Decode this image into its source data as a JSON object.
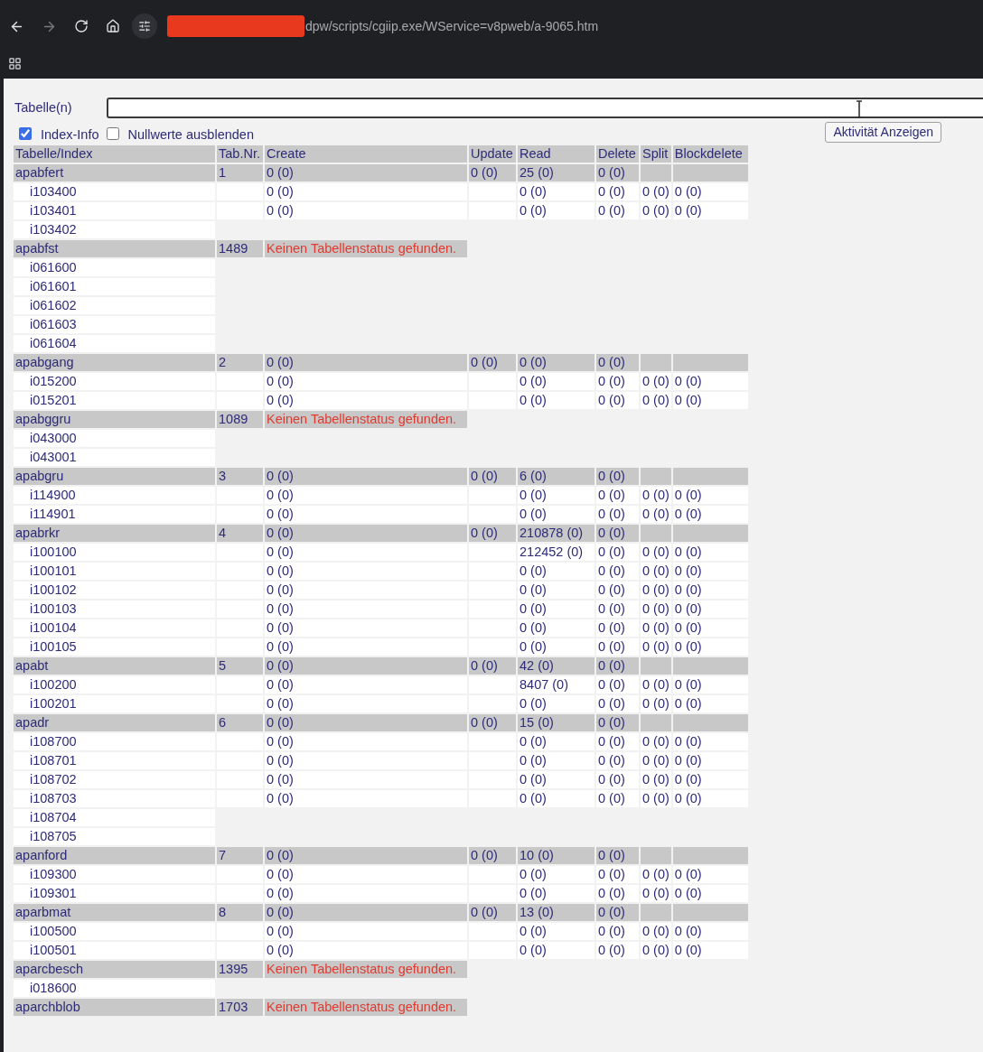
{
  "browser": {
    "url": "dpw/scripts/cgiip.exe/WService=v8pweb/a-9065.htm",
    "forward_disabled": true
  },
  "form": {
    "label": "Tabelle(n)",
    "checkboxes": [
      {
        "label": "Index-Info",
        "checked": true
      },
      {
        "label": "Nullwerte ausblenden",
        "checked": false
      }
    ],
    "button": "Aktivität Anzeigen"
  },
  "table": {
    "columns": [
      "Tabelle/Index",
      "Tab.Nr.",
      "Create",
      "Update",
      "Read",
      "Delete",
      "Split",
      "Blockdelete"
    ],
    "rows": [
      {
        "kind": "table",
        "name": "apabfert",
        "tab_nr": "1",
        "create": "0 (0)",
        "update": "0 (0)",
        "read": "25 (0)",
        "delete": "0 (0)"
      },
      {
        "kind": "index",
        "name": "i103400",
        "stats": {
          "create": "0 (0)",
          "read": "0 (0)",
          "delete": "0 (0)",
          "split": "0 (0)",
          "blockdelete": "0 (0)"
        }
      },
      {
        "kind": "index",
        "name": "i103401",
        "stats": {
          "create": "0 (0)",
          "read": "0 (0)",
          "delete": "0 (0)",
          "split": "0 (0)",
          "blockdelete": "0 (0)"
        }
      },
      {
        "kind": "index",
        "name": "i103402"
      },
      {
        "kind": "missing",
        "name": "apabfst",
        "tab_nr": "1489",
        "message": "Keinen Tabellenstatus gefunden."
      },
      {
        "kind": "index",
        "name": "i061600"
      },
      {
        "kind": "index",
        "name": "i061601"
      },
      {
        "kind": "index",
        "name": "i061602"
      },
      {
        "kind": "index",
        "name": "i061603"
      },
      {
        "kind": "index",
        "name": "i061604"
      },
      {
        "kind": "table",
        "name": "apabgang",
        "tab_nr": "2",
        "create": "0 (0)",
        "update": "0 (0)",
        "read": "0 (0)",
        "delete": "0 (0)"
      },
      {
        "kind": "index",
        "name": "i015200",
        "stats": {
          "create": "0 (0)",
          "read": "0 (0)",
          "delete": "0 (0)",
          "split": "0 (0)",
          "blockdelete": "0 (0)"
        }
      },
      {
        "kind": "index",
        "name": "i015201",
        "stats": {
          "create": "0 (0)",
          "read": "0 (0)",
          "delete": "0 (0)",
          "split": "0 (0)",
          "blockdelete": "0 (0)"
        }
      },
      {
        "kind": "missing",
        "name": "apabggru",
        "tab_nr": "1089",
        "message": "Keinen Tabellenstatus gefunden."
      },
      {
        "kind": "index",
        "name": "i043000"
      },
      {
        "kind": "index",
        "name": "i043001"
      },
      {
        "kind": "table",
        "name": "apabgru",
        "tab_nr": "3",
        "create": "0 (0)",
        "update": "0 (0)",
        "read": "6 (0)",
        "delete": "0 (0)"
      },
      {
        "kind": "index",
        "name": "i114900",
        "stats": {
          "create": "0 (0)",
          "read": "0 (0)",
          "delete": "0 (0)",
          "split": "0 (0)",
          "blockdelete": "0 (0)"
        }
      },
      {
        "kind": "index",
        "name": "i114901",
        "stats": {
          "create": "0 (0)",
          "read": "0 (0)",
          "delete": "0 (0)",
          "split": "0 (0)",
          "blockdelete": "0 (0)"
        }
      },
      {
        "kind": "table",
        "name": "apabrkr",
        "tab_nr": "4",
        "create": "0 (0)",
        "update": "0 (0)",
        "read": "210878 (0)",
        "delete": "0 (0)"
      },
      {
        "kind": "index",
        "name": "i100100",
        "stats": {
          "create": "0 (0)",
          "read": "212452 (0)",
          "delete": "0 (0)",
          "split": "0 (0)",
          "blockdelete": "0 (0)"
        }
      },
      {
        "kind": "index",
        "name": "i100101",
        "stats": {
          "create": "0 (0)",
          "read": "0 (0)",
          "delete": "0 (0)",
          "split": "0 (0)",
          "blockdelete": "0 (0)"
        }
      },
      {
        "kind": "index",
        "name": "i100102",
        "stats": {
          "create": "0 (0)",
          "read": "0 (0)",
          "delete": "0 (0)",
          "split": "0 (0)",
          "blockdelete": "0 (0)"
        }
      },
      {
        "kind": "index",
        "name": "i100103",
        "stats": {
          "create": "0 (0)",
          "read": "0 (0)",
          "delete": "0 (0)",
          "split": "0 (0)",
          "blockdelete": "0 (0)"
        }
      },
      {
        "kind": "index",
        "name": "i100104",
        "stats": {
          "create": "0 (0)",
          "read": "0 (0)",
          "delete": "0 (0)",
          "split": "0 (0)",
          "blockdelete": "0 (0)"
        }
      },
      {
        "kind": "index",
        "name": "i100105",
        "stats": {
          "create": "0 (0)",
          "read": "0 (0)",
          "delete": "0 (0)",
          "split": "0 (0)",
          "blockdelete": "0 (0)"
        }
      },
      {
        "kind": "table",
        "name": "apabt",
        "tab_nr": "5",
        "create": "0 (0)",
        "update": "0 (0)",
        "read": "42 (0)",
        "delete": "0 (0)"
      },
      {
        "kind": "index",
        "name": "i100200",
        "stats": {
          "create": "0 (0)",
          "read": "8407 (0)",
          "delete": "0 (0)",
          "split": "0 (0)",
          "blockdelete": "0 (0)"
        }
      },
      {
        "kind": "index",
        "name": "i100201",
        "stats": {
          "create": "0 (0)",
          "read": "0 (0)",
          "delete": "0 (0)",
          "split": "0 (0)",
          "blockdelete": "0 (0)"
        }
      },
      {
        "kind": "table",
        "name": "apadr",
        "tab_nr": "6",
        "create": "0 (0)",
        "update": "0 (0)",
        "read": "15 (0)",
        "delete": "0 (0)"
      },
      {
        "kind": "index",
        "name": "i108700",
        "stats": {
          "create": "0 (0)",
          "read": "0 (0)",
          "delete": "0 (0)",
          "split": "0 (0)",
          "blockdelete": "0 (0)"
        }
      },
      {
        "kind": "index",
        "name": "i108701",
        "stats": {
          "create": "0 (0)",
          "read": "0 (0)",
          "delete": "0 (0)",
          "split": "0 (0)",
          "blockdelete": "0 (0)"
        }
      },
      {
        "kind": "index",
        "name": "i108702",
        "stats": {
          "create": "0 (0)",
          "read": "0 (0)",
          "delete": "0 (0)",
          "split": "0 (0)",
          "blockdelete": "0 (0)"
        }
      },
      {
        "kind": "index",
        "name": "i108703",
        "stats": {
          "create": "0 (0)",
          "read": "0 (0)",
          "delete": "0 (0)",
          "split": "0 (0)",
          "blockdelete": "0 (0)"
        }
      },
      {
        "kind": "index",
        "name": "i108704"
      },
      {
        "kind": "index",
        "name": "i108705"
      },
      {
        "kind": "table",
        "name": "apanford",
        "tab_nr": "7",
        "create": "0 (0)",
        "update": "0 (0)",
        "read": "10 (0)",
        "delete": "0 (0)"
      },
      {
        "kind": "index",
        "name": "i109300",
        "stats": {
          "create": "0 (0)",
          "read": "0 (0)",
          "delete": "0 (0)",
          "split": "0 (0)",
          "blockdelete": "0 (0)"
        }
      },
      {
        "kind": "index",
        "name": "i109301",
        "stats": {
          "create": "0 (0)",
          "read": "0 (0)",
          "delete": "0 (0)",
          "split": "0 (0)",
          "blockdelete": "0 (0)"
        }
      },
      {
        "kind": "table",
        "name": "aparbmat",
        "tab_nr": "8",
        "create": "0 (0)",
        "update": "0 (0)",
        "read": "13 (0)",
        "delete": "0 (0)"
      },
      {
        "kind": "index",
        "name": "i100500",
        "stats": {
          "create": "0 (0)",
          "read": "0 (0)",
          "delete": "0 (0)",
          "split": "0 (0)",
          "blockdelete": "0 (0)"
        }
      },
      {
        "kind": "index",
        "name": "i100501",
        "stats": {
          "create": "0 (0)",
          "read": "0 (0)",
          "delete": "0 (0)",
          "split": "0 (0)",
          "blockdelete": "0 (0)"
        }
      },
      {
        "kind": "missing",
        "name": "aparcbesch",
        "tab_nr": "1395",
        "message": "Keinen Tabellenstatus gefunden."
      },
      {
        "kind": "index",
        "name": "i018600"
      },
      {
        "kind": "missing",
        "name": "aparchblob",
        "tab_nr": "1703",
        "message": "Keinen Tabellenstatus gefunden."
      }
    ]
  }
}
